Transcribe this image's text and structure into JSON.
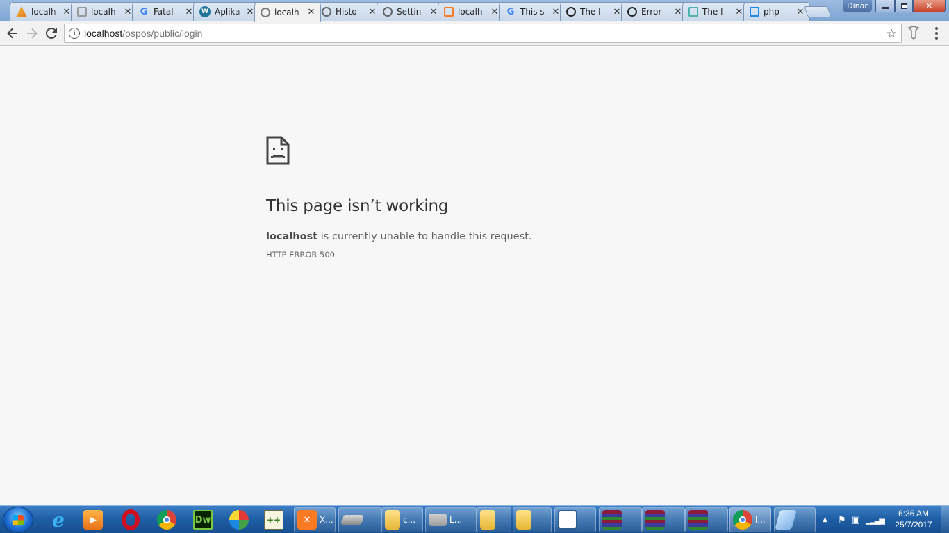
{
  "browser": {
    "tabs": [
      {
        "title": "localh",
        "icon": "pma-icon",
        "color": "#f29111",
        "glyph": "pma"
      },
      {
        "title": "localh",
        "icon": "document-icon",
        "color": "#999999",
        "glyph": ""
      },
      {
        "title": "Fatal",
        "icon": "google-icon",
        "color": "#4285f4",
        "glyph": "G"
      },
      {
        "title": "Aplika",
        "icon": "wordpress-icon",
        "color": "#21759b",
        "glyph": "W"
      },
      {
        "title": "localh",
        "icon": "ospos-icon",
        "color": "#777777",
        "glyph": "",
        "active": true
      },
      {
        "title": "Histo",
        "icon": "history-icon",
        "color": "#5f6368",
        "glyph": ""
      },
      {
        "title": "Settin",
        "icon": "gear-icon",
        "color": "#5f6368",
        "glyph": ""
      },
      {
        "title": "localh",
        "icon": "xampp-icon",
        "color": "#fb7a24",
        "glyph": ""
      },
      {
        "title": "This s",
        "icon": "google-icon",
        "color": "#4285f4",
        "glyph": "G"
      },
      {
        "title": "The l",
        "icon": "github-icon",
        "color": "#222222",
        "glyph": ""
      },
      {
        "title": "Error",
        "icon": "github-icon",
        "color": "#222222",
        "glyph": ""
      },
      {
        "title": "The l",
        "icon": "laravel-icon",
        "color": "#4db6ac",
        "glyph": ""
      },
      {
        "title": "php -",
        "icon": "stackoverflow-icon",
        "color": "#1e88e5",
        "glyph": ""
      }
    ],
    "window_user": "Dinar",
    "address": {
      "host": "localhost",
      "path": "/ospos/public/login"
    }
  },
  "error_page": {
    "title": "This page isn’t working",
    "message_host": "localhost",
    "message_rest": " is currently unable to handle this request.",
    "code": "HTTP ERROR 500"
  },
  "taskbar": {
    "window_labels": {
      "xampp": "X...",
      "folder1": "c...",
      "app2": "L...",
      "chrome": "l..."
    },
    "clock": {
      "time": "6:36 AM",
      "date": "25/7/2017"
    }
  }
}
